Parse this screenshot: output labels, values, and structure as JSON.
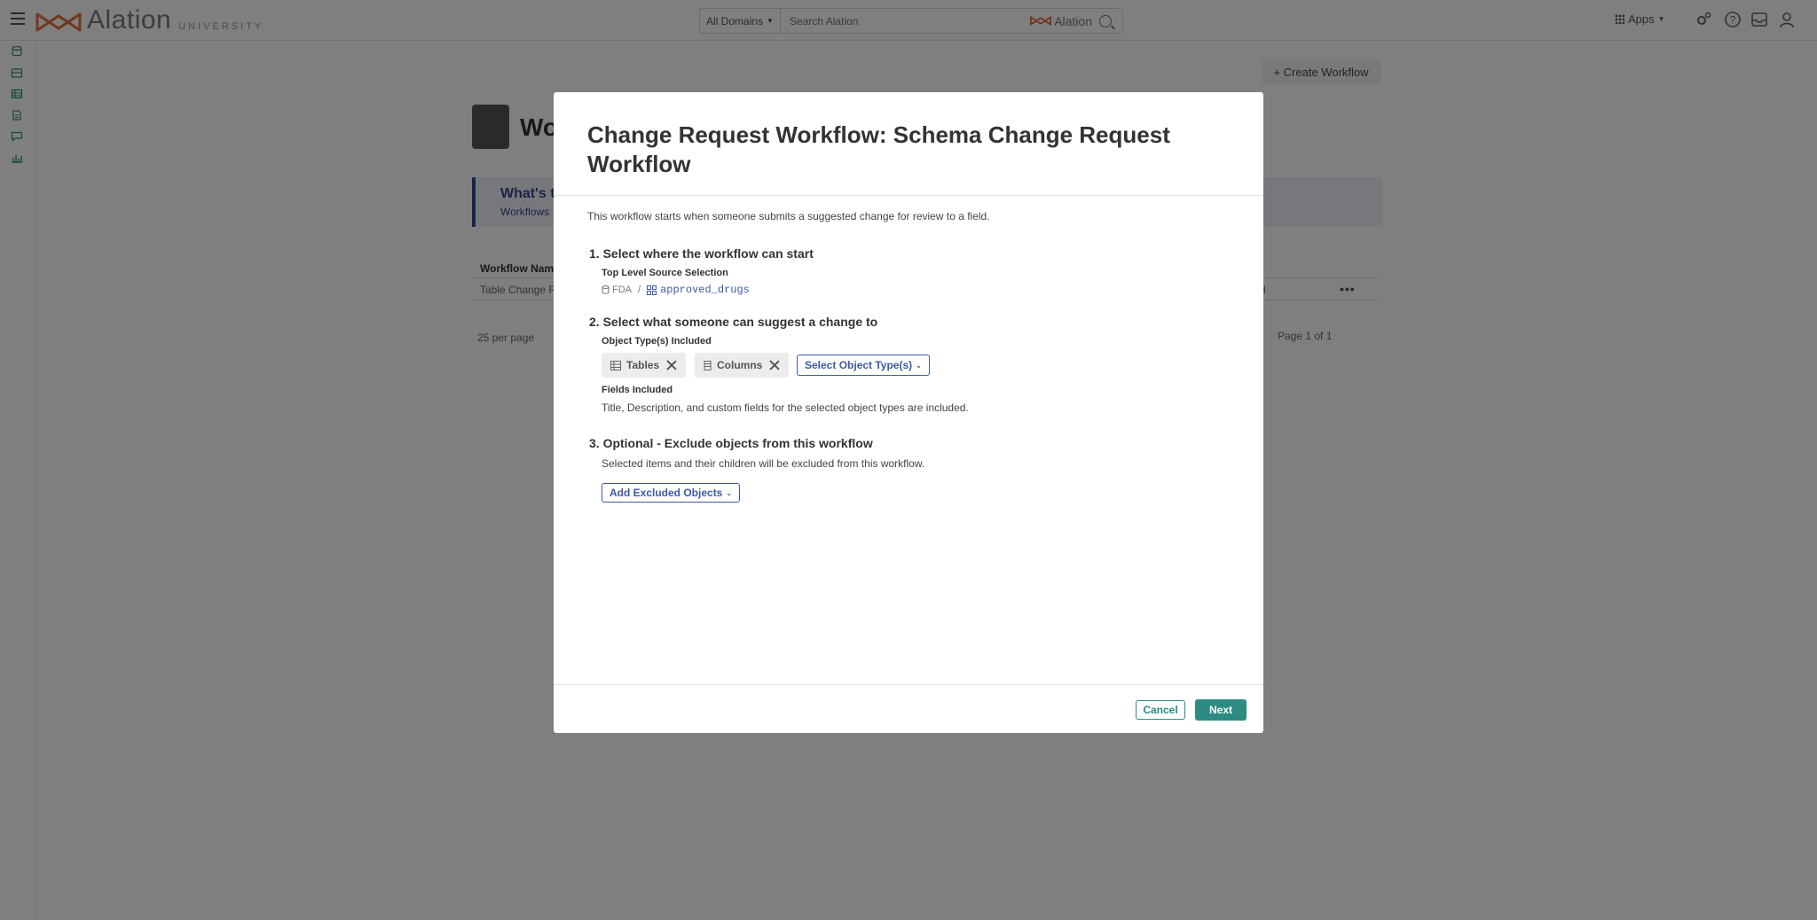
{
  "nav": {
    "brand": "Alation",
    "brand_sub": "UNIVERSITY",
    "domains": "All Domains",
    "search_placeholder": "Search Alation",
    "search_brand": "Alation",
    "apps": "Apps"
  },
  "background": {
    "create_button": "+ Create Workflow",
    "title": "Wo",
    "banner_title": "What's t",
    "banner_sub": "Workflows",
    "table_header": "Workflow Nam",
    "table_row": "Table Change R",
    "row_trailing": "d",
    "per_page": "25 per page",
    "page_info": "Page 1 of 1"
  },
  "modal": {
    "title": "Change Request Workflow: Schema Change Request Workflow",
    "intro": "This workflow starts when someone submits a suggested change for review to a field.",
    "step1": {
      "title": "1. Select where the workflow can start",
      "label": "Top Level Source Selection",
      "source": "FDA",
      "separator": "/",
      "schema": "approved_drugs"
    },
    "step2": {
      "title": "2. Select what someone can suggest a change to",
      "label": "Object Type(s) Included",
      "chips": [
        "Tables",
        "Columns"
      ],
      "select_button": "Select Object Type(s)",
      "fields_label": "Fields Included",
      "fields_text": "Title, Description, and custom fields for the selected object types are included."
    },
    "step3": {
      "title": "3. Optional - Exclude objects from this workflow",
      "text": "Selected items and their children will be excluded from this workflow.",
      "button": "Add Excluded Objects"
    },
    "cancel": "Cancel",
    "next": "Next"
  },
  "colors": {
    "teal": "#2d8b83",
    "link_blue": "#3d59a8",
    "brand_orange": "#e0703a"
  }
}
